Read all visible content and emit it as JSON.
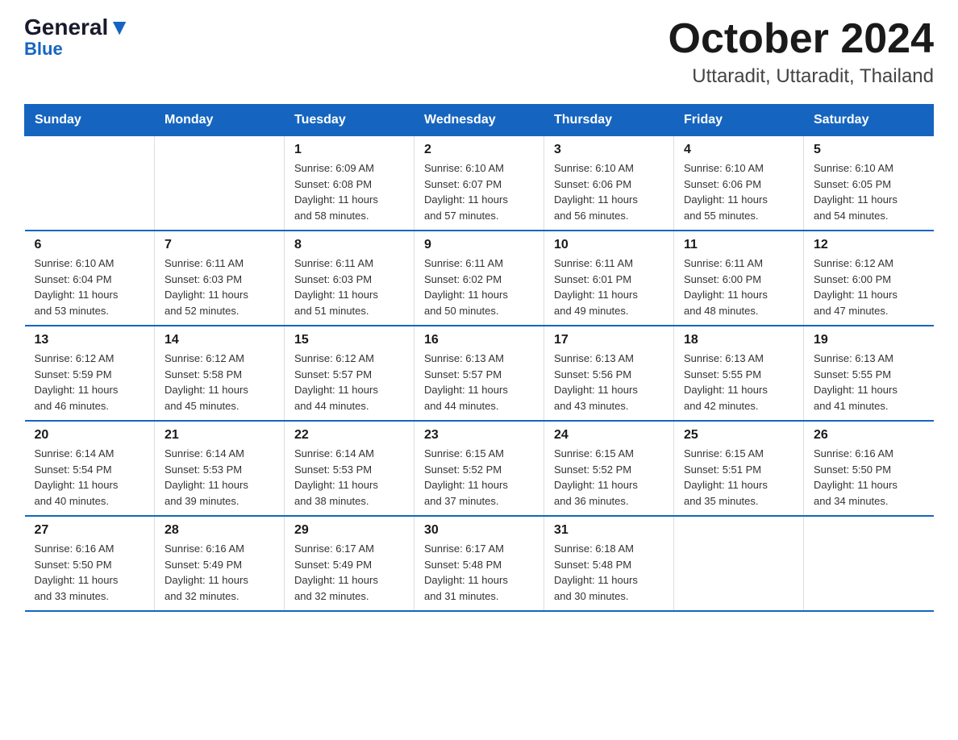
{
  "header": {
    "logo_general": "General",
    "logo_blue": "Blue",
    "month_title": "October 2024",
    "location": "Uttaradit, Uttaradit, Thailand"
  },
  "weekdays": [
    "Sunday",
    "Monday",
    "Tuesday",
    "Wednesday",
    "Thursday",
    "Friday",
    "Saturday"
  ],
  "weeks": [
    [
      {
        "day": "",
        "info": ""
      },
      {
        "day": "",
        "info": ""
      },
      {
        "day": "1",
        "info": "Sunrise: 6:09 AM\nSunset: 6:08 PM\nDaylight: 11 hours\nand 58 minutes."
      },
      {
        "day": "2",
        "info": "Sunrise: 6:10 AM\nSunset: 6:07 PM\nDaylight: 11 hours\nand 57 minutes."
      },
      {
        "day": "3",
        "info": "Sunrise: 6:10 AM\nSunset: 6:06 PM\nDaylight: 11 hours\nand 56 minutes."
      },
      {
        "day": "4",
        "info": "Sunrise: 6:10 AM\nSunset: 6:06 PM\nDaylight: 11 hours\nand 55 minutes."
      },
      {
        "day": "5",
        "info": "Sunrise: 6:10 AM\nSunset: 6:05 PM\nDaylight: 11 hours\nand 54 minutes."
      }
    ],
    [
      {
        "day": "6",
        "info": "Sunrise: 6:10 AM\nSunset: 6:04 PM\nDaylight: 11 hours\nand 53 minutes."
      },
      {
        "day": "7",
        "info": "Sunrise: 6:11 AM\nSunset: 6:03 PM\nDaylight: 11 hours\nand 52 minutes."
      },
      {
        "day": "8",
        "info": "Sunrise: 6:11 AM\nSunset: 6:03 PM\nDaylight: 11 hours\nand 51 minutes."
      },
      {
        "day": "9",
        "info": "Sunrise: 6:11 AM\nSunset: 6:02 PM\nDaylight: 11 hours\nand 50 minutes."
      },
      {
        "day": "10",
        "info": "Sunrise: 6:11 AM\nSunset: 6:01 PM\nDaylight: 11 hours\nand 49 minutes."
      },
      {
        "day": "11",
        "info": "Sunrise: 6:11 AM\nSunset: 6:00 PM\nDaylight: 11 hours\nand 48 minutes."
      },
      {
        "day": "12",
        "info": "Sunrise: 6:12 AM\nSunset: 6:00 PM\nDaylight: 11 hours\nand 47 minutes."
      }
    ],
    [
      {
        "day": "13",
        "info": "Sunrise: 6:12 AM\nSunset: 5:59 PM\nDaylight: 11 hours\nand 46 minutes."
      },
      {
        "day": "14",
        "info": "Sunrise: 6:12 AM\nSunset: 5:58 PM\nDaylight: 11 hours\nand 45 minutes."
      },
      {
        "day": "15",
        "info": "Sunrise: 6:12 AM\nSunset: 5:57 PM\nDaylight: 11 hours\nand 44 minutes."
      },
      {
        "day": "16",
        "info": "Sunrise: 6:13 AM\nSunset: 5:57 PM\nDaylight: 11 hours\nand 44 minutes."
      },
      {
        "day": "17",
        "info": "Sunrise: 6:13 AM\nSunset: 5:56 PM\nDaylight: 11 hours\nand 43 minutes."
      },
      {
        "day": "18",
        "info": "Sunrise: 6:13 AM\nSunset: 5:55 PM\nDaylight: 11 hours\nand 42 minutes."
      },
      {
        "day": "19",
        "info": "Sunrise: 6:13 AM\nSunset: 5:55 PM\nDaylight: 11 hours\nand 41 minutes."
      }
    ],
    [
      {
        "day": "20",
        "info": "Sunrise: 6:14 AM\nSunset: 5:54 PM\nDaylight: 11 hours\nand 40 minutes."
      },
      {
        "day": "21",
        "info": "Sunrise: 6:14 AM\nSunset: 5:53 PM\nDaylight: 11 hours\nand 39 minutes."
      },
      {
        "day": "22",
        "info": "Sunrise: 6:14 AM\nSunset: 5:53 PM\nDaylight: 11 hours\nand 38 minutes."
      },
      {
        "day": "23",
        "info": "Sunrise: 6:15 AM\nSunset: 5:52 PM\nDaylight: 11 hours\nand 37 minutes."
      },
      {
        "day": "24",
        "info": "Sunrise: 6:15 AM\nSunset: 5:52 PM\nDaylight: 11 hours\nand 36 minutes."
      },
      {
        "day": "25",
        "info": "Sunrise: 6:15 AM\nSunset: 5:51 PM\nDaylight: 11 hours\nand 35 minutes."
      },
      {
        "day": "26",
        "info": "Sunrise: 6:16 AM\nSunset: 5:50 PM\nDaylight: 11 hours\nand 34 minutes."
      }
    ],
    [
      {
        "day": "27",
        "info": "Sunrise: 6:16 AM\nSunset: 5:50 PM\nDaylight: 11 hours\nand 33 minutes."
      },
      {
        "day": "28",
        "info": "Sunrise: 6:16 AM\nSunset: 5:49 PM\nDaylight: 11 hours\nand 32 minutes."
      },
      {
        "day": "29",
        "info": "Sunrise: 6:17 AM\nSunset: 5:49 PM\nDaylight: 11 hours\nand 32 minutes."
      },
      {
        "day": "30",
        "info": "Sunrise: 6:17 AM\nSunset: 5:48 PM\nDaylight: 11 hours\nand 31 minutes."
      },
      {
        "day": "31",
        "info": "Sunrise: 6:18 AM\nSunset: 5:48 PM\nDaylight: 11 hours\nand 30 minutes."
      },
      {
        "day": "",
        "info": ""
      },
      {
        "day": "",
        "info": ""
      }
    ]
  ]
}
